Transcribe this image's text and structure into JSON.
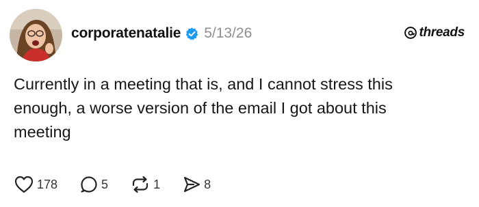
{
  "post": {
    "username": "corporatenatalie",
    "date": "5/13/26",
    "brand": "threads",
    "body_lines": [
      "Currently in a meeting that is, and I cannot stress this",
      "enough, a worse version of the email I got about this",
      "meeting"
    ],
    "actions": {
      "likes": "178",
      "comments": "5",
      "reposts": "1",
      "shares": "8"
    }
  },
  "colors": {
    "verified": "#1d9bf0",
    "secondary_text": "#8e8e8e",
    "text": "#111111"
  },
  "icons": [
    "avatar",
    "verified-badge-icon",
    "threads-logo-icon",
    "heart-icon",
    "comment-icon",
    "repost-icon",
    "share-icon"
  ]
}
